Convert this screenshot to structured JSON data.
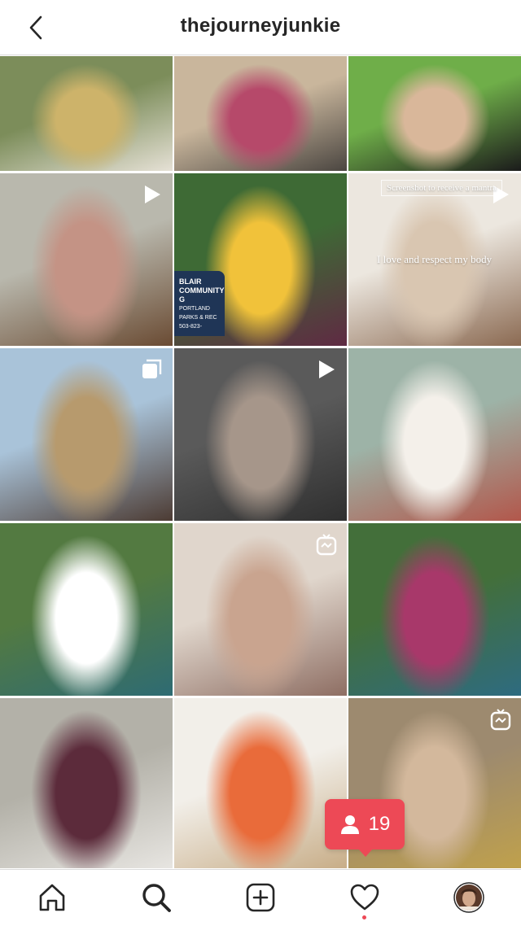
{
  "header": {
    "title": "thejourneyjunkie",
    "back_icon": "chevron-left-icon"
  },
  "grid": {
    "tiles": [
      {
        "subject": "woman in yellow kimono on garden path",
        "colors": [
          "#7c8d5a",
          "#cdb36a",
          "#e6e1d6"
        ],
        "badge": null
      },
      {
        "subject": "selfie in car with sunglasses",
        "colors": [
          "#c9b69c",
          "#b6496a",
          "#4b4641"
        ],
        "badge": null
      },
      {
        "subject": "selfie in hammock",
        "colors": [
          "#6fae49",
          "#d9b79a",
          "#1b1b1b"
        ],
        "badge": null
      },
      {
        "subject": "yoga pose with exercise ball",
        "colors": [
          "#b9b8ad",
          "#c49385",
          "#6a4b33"
        ],
        "badge": "video"
      },
      {
        "subject": "sunflower selfie with sunglasses",
        "colors": [
          "#3e6a35",
          "#f1c23a",
          "#5f2a43"
        ],
        "badge": null
      },
      {
        "subject": "woman on couch with mantra text",
        "colors": [
          "#ece7df",
          "#d9c6b1",
          "#8b6a52"
        ],
        "badge": "video"
      },
      {
        "subject": "couple at canyon waterfall",
        "colors": [
          "#a9c3d9",
          "#b79a6d",
          "#4c3b33"
        ],
        "badge": "carousel"
      },
      {
        "subject": "stretching on mat in kitchen",
        "colors": [
          "#5a5a5a",
          "#a6968a",
          "#2f2f2f"
        ],
        "badge": "video"
      },
      {
        "subject": "woman in white on cushion",
        "colors": [
          "#9db3a7",
          "#f4f0ea",
          "#b2574b"
        ],
        "badge": null
      },
      {
        "subject": "yoga stretch on patio",
        "colors": [
          "#537a41",
          "#ffffff",
          "#2e6b73"
        ],
        "badge": null
      },
      {
        "subject": "smiling portrait with necklaces",
        "colors": [
          "#e0d6cc",
          "#c9a48f",
          "#8e6e63"
        ],
        "badge": "igtv"
      },
      {
        "subject": "namaste pose in garden",
        "colors": [
          "#436f3a",
          "#a8386a",
          "#2e6b80"
        ],
        "badge": null
      },
      {
        "subject": "downward dog on yoga mat",
        "colors": [
          "#b3b1a8",
          "#5c2b3b",
          "#e8e6e2"
        ],
        "badge": null
      },
      {
        "subject": "lying on rug with cards",
        "colors": [
          "#f2efe9",
          "#e96b3a",
          "#c7ac86"
        ],
        "badge": null
      },
      {
        "subject": "portrait with plants",
        "colors": [
          "#9d8a6f",
          "#d3b89c",
          "#c0a14b"
        ],
        "badge": "igtv"
      }
    ],
    "overlay_text": {
      "mantra_banner": "Screenshot to receive a mantra",
      "mantra_line": "I love and respect my body",
      "sign_lines": [
        "BLAIR",
        "COMMUNITY G",
        "PORTLAND PARKS & REC",
        "503-823-"
      ]
    }
  },
  "notification": {
    "icon": "person-icon",
    "count": "19",
    "color": "#ed4956"
  },
  "bottom_nav": {
    "items": [
      {
        "icon": "home-icon"
      },
      {
        "icon": "search-icon"
      },
      {
        "icon": "plus-square-icon"
      },
      {
        "icon": "heart-icon"
      },
      {
        "icon": "profile-avatar"
      }
    ]
  }
}
